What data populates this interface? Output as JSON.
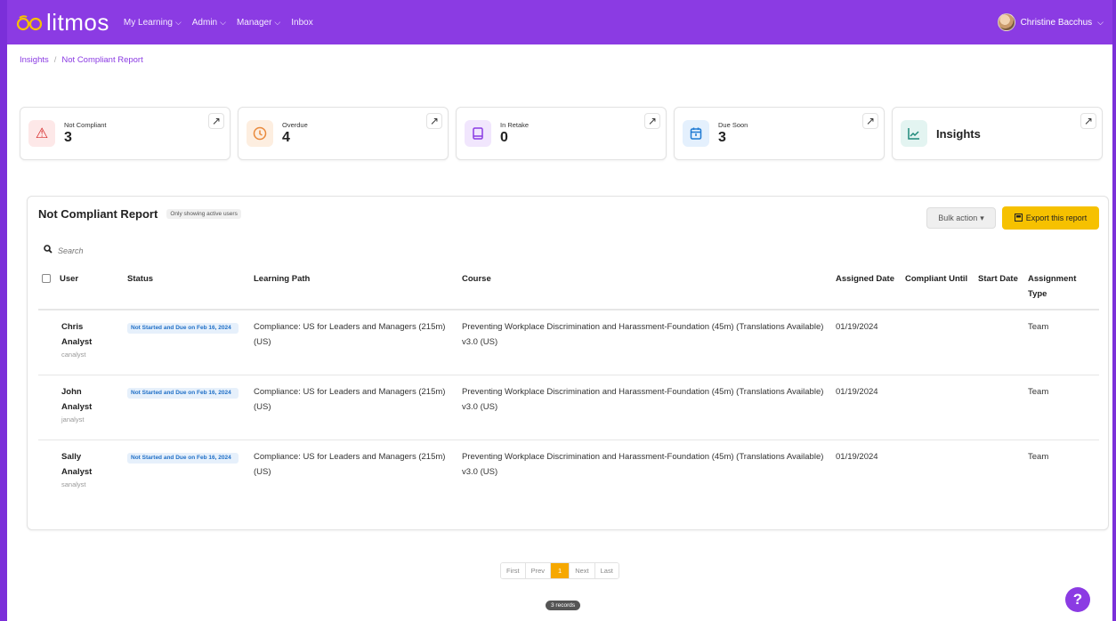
{
  "app": {
    "logo_text": "litmos"
  },
  "nav": {
    "items": [
      {
        "label": "My Learning",
        "has_dropdown": true
      },
      {
        "label": "Admin",
        "has_dropdown": true
      },
      {
        "label": "Manager",
        "has_dropdown": true
      },
      {
        "label": "Inbox",
        "has_dropdown": false
      }
    ],
    "user_name": "Christine Bacchus"
  },
  "breadcrumb": {
    "items": [
      "Insights",
      "Not Compliant Report"
    ]
  },
  "cards": [
    {
      "label": "Not Compliant",
      "value": "3",
      "icon": "warning-icon"
    },
    {
      "label": "Overdue",
      "value": "4",
      "icon": "clock-icon"
    },
    {
      "label": "In Retake",
      "value": "0",
      "icon": "book-icon"
    },
    {
      "label": "Due Soon",
      "value": "3",
      "icon": "calendar-icon"
    },
    {
      "label": "Insights",
      "value": "",
      "icon": "trend-icon"
    }
  ],
  "report": {
    "title": "Not Compliant Report",
    "badge": "Only showing active users",
    "bulk_action_label": "Bulk action",
    "export_label": "Export this report",
    "search_placeholder": "Search",
    "columns": {
      "user": "User",
      "status": "Status",
      "learning_path": "Learning Path",
      "course": "Course",
      "assigned_date": "Assigned Date",
      "compliant_until": "Compliant Until",
      "start_date": "Start Date",
      "assignment_type": "Assignment Type"
    },
    "rows": [
      {
        "first": "Chris",
        "last": "Analyst",
        "handle": "canalyst",
        "status": "Not Started and Due on Feb 16, 2024",
        "learning_path": "Compliance: US for Leaders and Managers (215m) (US)",
        "course": "Preventing Workplace Discrimination and Harassment-Foundation (45m) (Translations Available) v3.0 (US)",
        "assigned_date": "01/19/2024",
        "compliant_until": "",
        "start_date": "",
        "assignment_type": "Team"
      },
      {
        "first": "John",
        "last": "Analyst",
        "handle": "janalyst",
        "status": "Not Started and Due on Feb 16, 2024",
        "learning_path": "Compliance: US for Leaders and Managers (215m) (US)",
        "course": "Preventing Workplace Discrimination and Harassment-Foundation (45m) (Translations Available) v3.0 (US)",
        "assigned_date": "01/19/2024",
        "compliant_until": "",
        "start_date": "",
        "assignment_type": "Team"
      },
      {
        "first": "Sally",
        "last": "Analyst",
        "handle": "sanalyst",
        "status": "Not Started and Due on Feb 16, 2024",
        "learning_path": "Compliance: US for Leaders and Managers (215m) (US)",
        "course": "Preventing Workplace Discrimination and Harassment-Foundation (45m) (Translations Available) v3.0 (US)",
        "assigned_date": "01/19/2024",
        "compliant_until": "",
        "start_date": "",
        "assignment_type": "Team"
      }
    ]
  },
  "pagination": {
    "first": "First",
    "prev": "Prev",
    "current": "1",
    "next": "Next",
    "last": "Last",
    "records": "3 records"
  },
  "help": {
    "label": "?"
  },
  "colors": {
    "brand": "#8b3be3",
    "accent": "#f6c100",
    "status_blue": "#1f6fc7"
  }
}
